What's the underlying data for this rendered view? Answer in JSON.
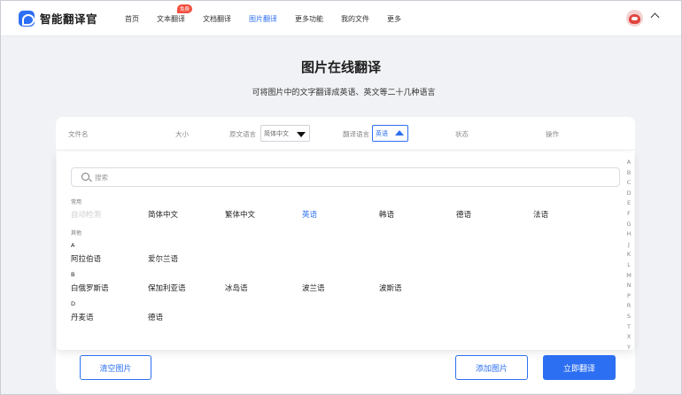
{
  "header": {
    "logo_text": "智能翻译官",
    "nav": [
      {
        "label": "首页"
      },
      {
        "label": "文本翻译",
        "badge": "免费"
      },
      {
        "label": "文档翻译"
      },
      {
        "label": "图片翻译",
        "active": true
      },
      {
        "label": "更多功能"
      },
      {
        "label": "我的文件"
      },
      {
        "label": "更多"
      }
    ]
  },
  "main": {
    "title": "图片在线翻译",
    "subtitle": "可将图片中的文字翻译成英语、英文等二十几种语言"
  },
  "table": {
    "headers": {
      "filename": "文件名",
      "size": "大小",
      "source_lang": "原文语言",
      "target_lang": "翻译语言",
      "status": "状态",
      "action": "操作"
    },
    "source_value": "简体中文",
    "target_value": "英语"
  },
  "language_panel": {
    "search_placeholder": "搜索",
    "common_label": "常用",
    "common": [
      "自动检测",
      "简体中文",
      "繁体中文",
      "英语",
      "韩语",
      "德语",
      "法语"
    ],
    "other_label": "其他",
    "groups": [
      {
        "letter": "A",
        "items": [
          "阿拉伯语",
          "爱尔兰语"
        ]
      },
      {
        "letter": "B",
        "items": [
          "白俄罗斯语",
          "保加利亚语",
          "冰岛语",
          "波兰语",
          "波斯语"
        ]
      },
      {
        "letter": "D",
        "items": [
          "丹麦语",
          "德语"
        ]
      }
    ],
    "alphabet": [
      "A",
      "B",
      "C",
      "D",
      "E",
      "F",
      "G",
      "H",
      "J",
      "K",
      "L",
      "M",
      "N",
      "P",
      "R",
      "S",
      "T",
      "X",
      "Y"
    ]
  },
  "buttons": {
    "clear": "清空图片",
    "add": "添加图片",
    "translate": "立即翻译"
  },
  "colors": {
    "accent": "#2c6ff2",
    "badge": "#f24f3f",
    "background": "#f1f2f5"
  }
}
